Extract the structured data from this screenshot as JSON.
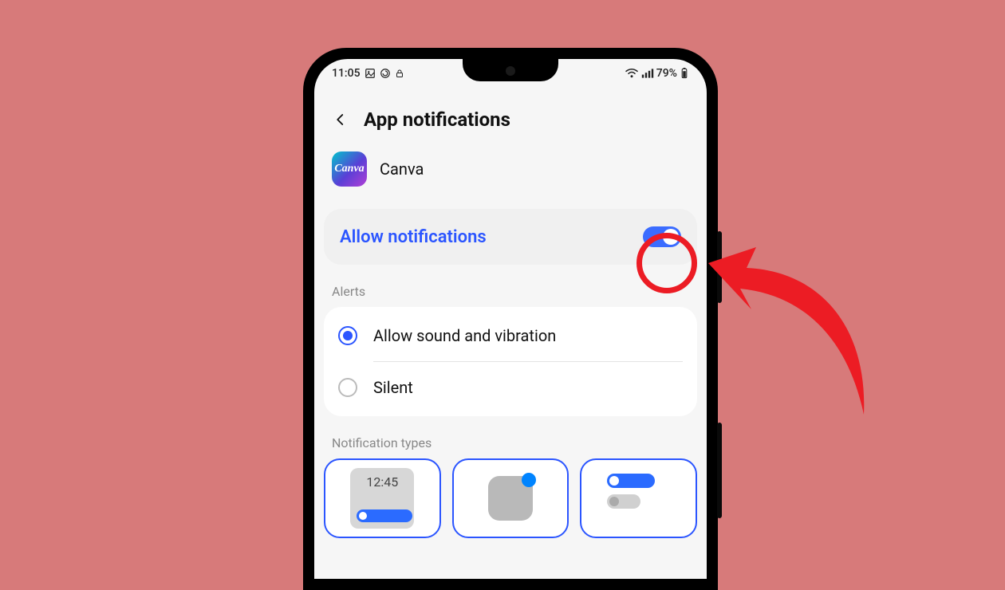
{
  "status": {
    "time": "11:05",
    "battery": "79%"
  },
  "header": {
    "title": "App notifications"
  },
  "app": {
    "name": "Canva",
    "icon_text": "Canva"
  },
  "allow": {
    "label": "Allow notifications",
    "enabled": true
  },
  "sections": {
    "alerts_label": "Alerts",
    "types_label": "Notification types"
  },
  "alerts": {
    "options": [
      {
        "label": "Allow sound and vibration",
        "selected": true
      },
      {
        "label": "Silent",
        "selected": false
      }
    ]
  },
  "types": {
    "lock_time": "12:45"
  },
  "annotation": {
    "target": "allow-notifications-toggle",
    "color": "#ec1c24"
  }
}
